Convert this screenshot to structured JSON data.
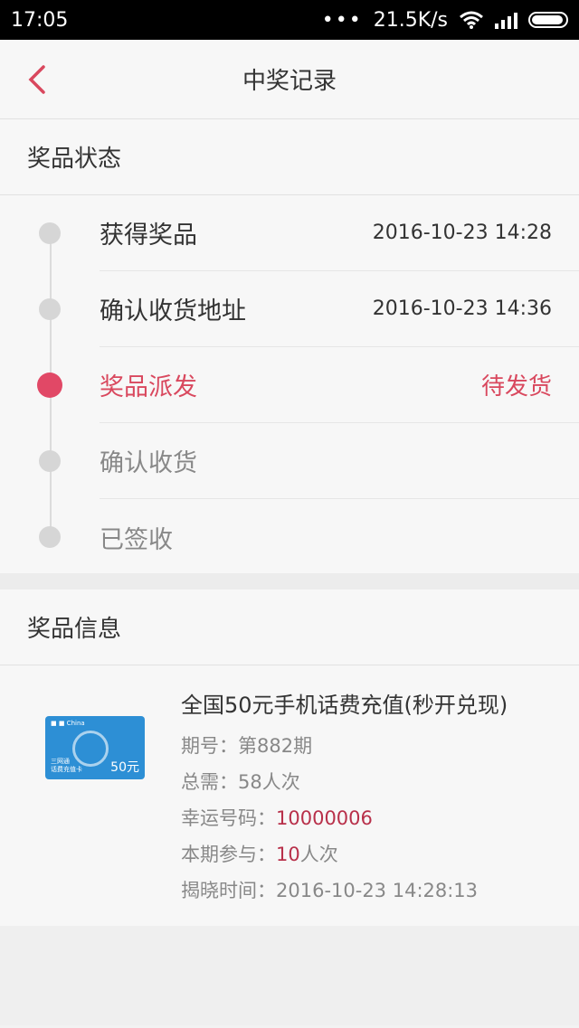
{
  "status": {
    "time": "17:05",
    "speed": "21.5K/s"
  },
  "appbar": {
    "title": "中奖记录"
  },
  "status_section": {
    "title": "奖品状态",
    "steps": [
      {
        "label": "获得奖品",
        "time": "2016-10-23 14:28"
      },
      {
        "label": "确认收货地址",
        "time": "2016-10-23 14:36"
      },
      {
        "label": "奖品派发",
        "status": "待发货"
      },
      {
        "label": "确认收货"
      },
      {
        "label": "已签收"
      }
    ]
  },
  "info_section": {
    "title": "奖品信息",
    "prize_name": "全国50元手机话费充值(秒开兑现)",
    "issue_label": "期号：",
    "issue": "第882期",
    "total_label": "总需：",
    "total": "58人次",
    "lucky_label": "幸运号码：",
    "lucky": "10000006",
    "joined_label": "本期参与：",
    "joined_num": "10",
    "joined_unit": "人次",
    "reveal_label": "揭晓时间：",
    "reveal": "2016-10-23 14:28:13",
    "card_amount": "50元",
    "card_line1": "三网通",
    "card_line2": "话费充值卡"
  },
  "colors": {
    "accent": "#e14866",
    "highlight": "#b8304a",
    "card": "#2d8fd5"
  }
}
